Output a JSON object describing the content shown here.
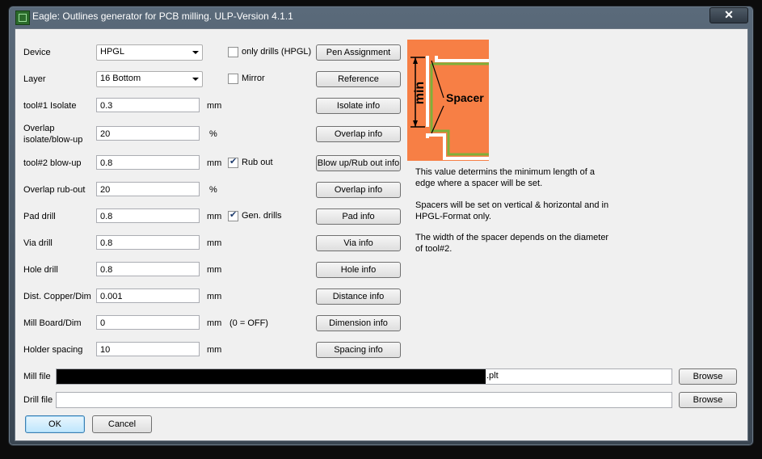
{
  "window": {
    "title": "Eagle: Outlines generator for PCB milling. ULP-Version 4.1.1",
    "close_label": "✕"
  },
  "fields": {
    "device": {
      "label": "Device",
      "value": "HPGL"
    },
    "layer": {
      "label": "Layer",
      "value": "16  Bottom"
    },
    "tool1_isolate": {
      "label": "tool#1 Isolate",
      "value": "0.3",
      "unit": "mm"
    },
    "overlap_isolate": {
      "label_1": "Overlap",
      "label_2": "isolate/blow-up",
      "value": "20",
      "unit": "%"
    },
    "tool2_blowup": {
      "label": "tool#2 blow-up",
      "value": "0.8",
      "unit": "mm"
    },
    "overlap_rubout": {
      "label": "Overlap rub-out",
      "value": "20",
      "unit": "%"
    },
    "pad_drill": {
      "label": "Pad drill",
      "value": "0.8",
      "unit": "mm"
    },
    "via_drill": {
      "label": "Via drill",
      "value": "0.8",
      "unit": "mm"
    },
    "hole_drill": {
      "label": "Hole drill",
      "value": "0.8",
      "unit": "mm"
    },
    "dist_copper": {
      "label": "Dist. Copper/Dim",
      "value": "0.001",
      "unit": "mm"
    },
    "mill_board": {
      "label": "Mill Board/Dim",
      "value": "0",
      "unit": "mm",
      "note": "(0 = OFF)"
    },
    "holder_spacing": {
      "label": "Holder spacing",
      "value": "10",
      "unit": "mm"
    }
  },
  "checkboxes": {
    "only_drills": {
      "label": "only drills (HPGL)",
      "checked": false
    },
    "mirror": {
      "label": "Mirror",
      "checked": false
    },
    "rub_out": {
      "label": "Rub out",
      "checked": true
    },
    "gen_drills": {
      "label": "Gen. drills",
      "checked": true
    }
  },
  "buttons": {
    "pen_assignment": "Pen Assignment",
    "reference": "Reference",
    "isolate_info": "Isolate info",
    "overlap_info_1": "Overlap info",
    "blowup_rubout_info": "Blow up/Rub out info",
    "overlap_info_2": "Overlap info",
    "pad_info": "Pad info",
    "via_info": "Via info",
    "hole_info": "Hole info",
    "distance_info": "Distance info",
    "dimension_info": "Dimension info",
    "spacing_info": "Spacing info",
    "browse_mill": "Browse",
    "browse_drill": "Browse",
    "ok": "OK",
    "cancel": "Cancel"
  },
  "files": {
    "mill_label": "Mill file",
    "mill_suffix": ".plt",
    "drill_label": "Drill file",
    "drill_value": ""
  },
  "diagram": {
    "min_label": "min",
    "spacer_label": "Spacer",
    "colors": {
      "bg": "#f77f45",
      "copper": "#7fb03a",
      "cut": "#ffffff"
    }
  },
  "info": {
    "p1": "This value determins the minimum length of a edge where a spacer will be set.",
    "p2": "Spacers will be set on vertical & horizontal and in HPGL-Format only.",
    "p3": "The width of the spacer depends on the diameter of tool#2."
  }
}
